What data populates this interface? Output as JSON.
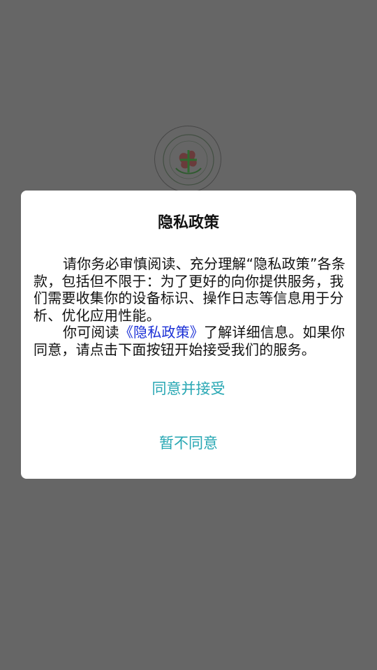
{
  "background_color": "#666666",
  "logo": {
    "icon": "hospital-logo-icon"
  },
  "dialog": {
    "title": "隐私政策",
    "paragraph1": "请你务必审慎阅读、充分理解“隐私政策”各条款，包括但不限于：为了更好的向你提供服务，我们需要收集你的设备标识、操作日志等信息用于分析、优化应用性能。",
    "paragraph2_before": "你可阅读",
    "paragraph2_link": "《隐私政策》",
    "paragraph2_after": "了解详细信息。如果你同意，请点击下面按钮开始接受我们的服务。",
    "agree_label": "同意并接受",
    "decline_label": "暂不同意"
  },
  "colors": {
    "accent": "#27a7b3",
    "link": "#1a2fd6",
    "dialog_bg": "#ffffff"
  }
}
